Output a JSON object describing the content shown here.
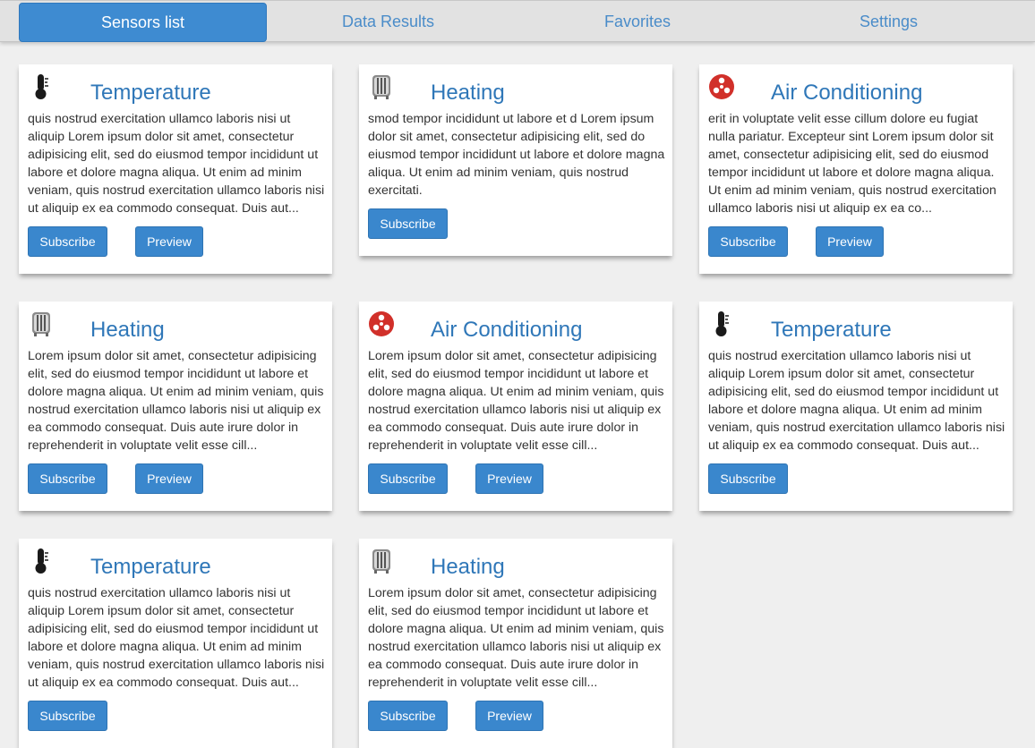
{
  "nav": {
    "tabs": [
      {
        "label": "Sensors list"
      },
      {
        "label": "Data Results"
      },
      {
        "label": "Favorites"
      },
      {
        "label": "Settings"
      }
    ]
  },
  "cards": [
    {
      "icon": "thermometer-icon",
      "title": "Temperature",
      "text": "quis nostrud exercitation ullamco laboris nisi ut aliquip Lorem ipsum dolor sit amet, consectetur adipisicing elit, sed do eiusmod tempor incididunt ut labore et dolore magna aliqua. Ut enim ad minim veniam, quis nostrud exercitation ullamco laboris nisi ut aliquip ex ea commodo consequat. Duis aut...",
      "subscribe": "Subscribe",
      "preview": "Preview"
    },
    {
      "icon": "radiator-icon",
      "title": "Heating",
      "text": "smod tempor incididunt ut labore et d Lorem ipsum dolor sit amet, consectetur adipisicing elit, sed do eiusmod tempor incididunt ut labore et dolore magna aliqua. Ut enim ad minim veniam, quis nostrud exercitati.",
      "subscribe": "Subscribe"
    },
    {
      "icon": "air-conditioning-icon",
      "title": "Air Conditioning",
      "text": "erit in voluptate velit esse cillum dolore eu fugiat nulla pariatur. Excepteur sint Lorem ipsum dolor sit amet, consectetur adipisicing elit, sed do eiusmod tempor incididunt ut labore et dolore magna aliqua. Ut enim ad minim veniam, quis nostrud exercitation ullamco laboris nisi ut aliquip ex ea co...",
      "subscribe": "Subscribe",
      "preview": "Preview"
    },
    {
      "icon": "radiator-icon",
      "title": "Heating",
      "text": "Lorem ipsum dolor sit amet, consectetur adipisicing elit, sed do eiusmod tempor incididunt ut labore et dolore magna aliqua. Ut enim ad minim veniam, quis nostrud exercitation ullamco laboris nisi ut aliquip ex ea commodo consequat. Duis aute irure dolor in reprehenderit in voluptate velit esse cill...",
      "subscribe": "Subscribe",
      "preview": "Preview"
    },
    {
      "icon": "air-conditioning-icon",
      "title": "Air Conditioning",
      "text": "Lorem ipsum dolor sit amet, consectetur adipisicing elit, sed do eiusmod tempor incididunt ut labore et dolore magna aliqua. Ut enim ad minim veniam, quis nostrud exercitation ullamco laboris nisi ut aliquip ex ea commodo consequat. Duis aute irure dolor in reprehenderit in voluptate velit esse cill...",
      "subscribe": "Subscribe",
      "preview": "Preview"
    },
    {
      "icon": "thermometer-icon",
      "title": "Temperature",
      "text": "quis nostrud exercitation ullamco laboris nisi ut aliquip Lorem ipsum dolor sit amet, consectetur adipisicing elit, sed do eiusmod tempor incididunt ut labore et dolore magna aliqua. Ut enim ad minim veniam, quis nostrud exercitation ullamco laboris nisi ut aliquip ex ea commodo consequat. Duis aut...",
      "subscribe": "Subscribe"
    },
    {
      "icon": "thermometer-icon",
      "title": "Temperature",
      "text": "quis nostrud exercitation ullamco laboris nisi ut aliquip Lorem ipsum dolor sit amet, consectetur adipisicing elit, sed do eiusmod tempor incididunt ut labore et dolore magna aliqua. Ut enim ad minim veniam, quis nostrud exercitation ullamco laboris nisi ut aliquip ex ea commodo consequat. Duis aut...",
      "subscribe": "Subscribe"
    },
    {
      "icon": "radiator-icon",
      "title": "Heating",
      "text": "Lorem ipsum dolor sit amet, consectetur adipisicing elit, sed do eiusmod tempor incididunt ut labore et dolore magna aliqua. Ut enim ad minim veniam, quis nostrud exercitation ullamco laboris nisi ut aliquip ex ea commodo consequat. Duis aute irure dolor in reprehenderit in voluptate velit esse cill...",
      "subscribe": "Subscribe",
      "preview": "Preview"
    }
  ],
  "colors": {
    "accent": "#3a87cd",
    "title": "#2f77b8",
    "ac_icon": "#d1302a"
  }
}
